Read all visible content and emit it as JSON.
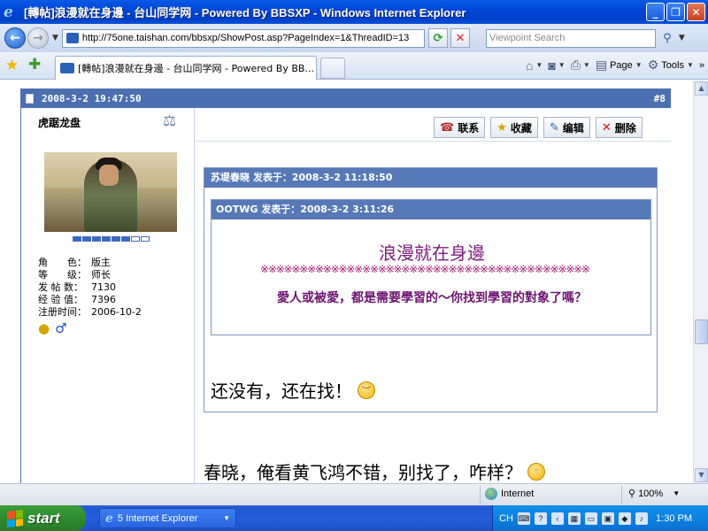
{
  "window": {
    "title": "[轉帖]浪漫就在身邊 - 台山同学网 - Powered By BBSXP - Windows Internet Explorer",
    "minimize": "_",
    "restore": "❐",
    "close": "✕"
  },
  "address": {
    "url": "http://75one.taishan.com/bbsxp/ShowPost.asp?PageIndex=1&ThreadID=13",
    "search_placeholder": "Viewpoint Search"
  },
  "tabs": [
    {
      "label": "[轉帖]浪漫就在身邊 - 台山同学网 - Powered By BB..."
    }
  ],
  "toolbar": {
    "page_label": "Page",
    "tools_label": "Tools",
    "more": "»"
  },
  "post": {
    "timestamp": "2008-3-2 19:47:50",
    "floor": "#8",
    "author": {
      "name": "虎踞龙盘",
      "info": [
        {
          "key": "角　　色：",
          "value": "版主"
        },
        {
          "key": "等　　级：",
          "value": "师长"
        },
        {
          "key": "发 帖 数：",
          "value": "7130"
        },
        {
          "key": "经 验 值：",
          "value": "7396"
        },
        {
          "key": "注册时间：",
          "value": "2006-10-2"
        }
      ],
      "rank_filled": 6,
      "rank_total": 8
    },
    "actions": {
      "contact": "联系",
      "favorite": "收藏",
      "edit": "编辑",
      "delete": "删除"
    },
    "outer_quote": {
      "header": "苏堤春晓 发表于：2008-3-2 11:18:50",
      "reply": "还没有，还在找！"
    },
    "inner_quote": {
      "header": "OOTWG 发表于：2008-3-2 3:11:26",
      "title": "浪漫就在身邊",
      "decoration": "※※※※※※※※※※※※※※※※※※※※※※※※※※※※※※※※※※※※※※※※※※",
      "line": "愛人或被愛，都是需要學習的～你找到學習的對象了嗎？"
    },
    "body": "春晓，俺看黄飞鸿不错，别找了，咋样？"
  },
  "status": {
    "zone": "Internet",
    "zoom": "100%"
  },
  "taskbar": {
    "start": "start",
    "item": "5 Internet Explorer",
    "lang": "CH",
    "clock": "1:30 PM"
  }
}
